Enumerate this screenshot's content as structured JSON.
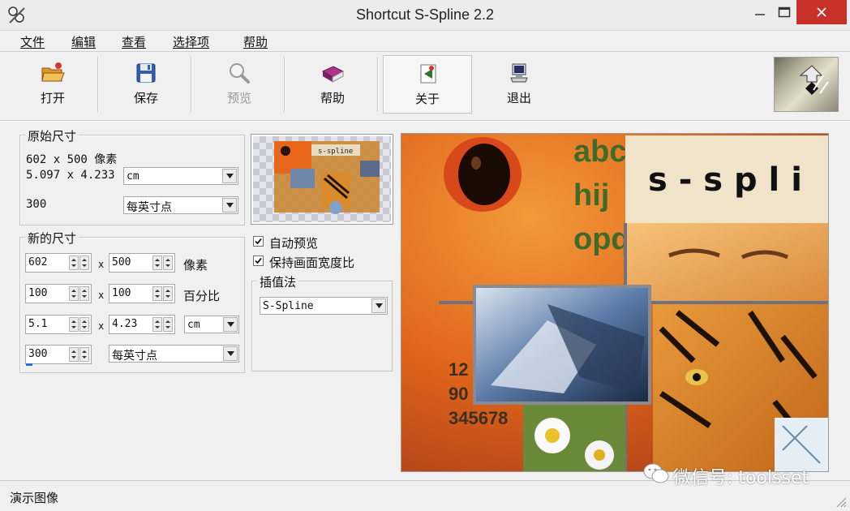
{
  "window": {
    "title": "Shortcut S-Spline 2.2"
  },
  "menu": [
    "文件",
    "编辑",
    "查看",
    "选择项",
    "帮助"
  ],
  "toolbar": {
    "open": "打开",
    "save": "保存",
    "preview": "预览",
    "help": "帮助",
    "about": "关于",
    "exit": "退出"
  },
  "original_size": {
    "title": "原始尺寸",
    "pixels": "602 x 500 像素",
    "dimensions": "5.097 x 4.233",
    "unit": "cm",
    "resolution": "300",
    "resolution_unit": "每英寸点"
  },
  "new_size": {
    "title": "新的尺寸",
    "width_px": "602",
    "height_px": "500",
    "pixels_label": "像素",
    "width_pct": "100",
    "height_pct": "100",
    "percent_label": "百分比",
    "width_unit": "5.1",
    "height_unit": "4.23",
    "unit": "cm",
    "resolution": "300",
    "resolution_unit": "每英寸点",
    "times": "x"
  },
  "options": {
    "auto_preview": "自动预览",
    "auto_preview_checked": true,
    "keep_aspect": "保持画面宽度比",
    "keep_aspect_checked": true
  },
  "interpolation": {
    "title": "插值法",
    "value": "S-Spline"
  },
  "preview_image": {
    "text_banner": "s - s p l i",
    "letters": [
      "abc",
      "hij",
      "opqr"
    ],
    "numbers": [
      "12",
      "90",
      "345678"
    ]
  },
  "thumbnail": {
    "banner": "s-spline"
  },
  "status": {
    "text": "演示图像"
  },
  "watermark": {
    "text": "微信号: toolsset"
  },
  "colors": {
    "close_button": "#c7312a",
    "window_bg": "#f0f0f0"
  }
}
